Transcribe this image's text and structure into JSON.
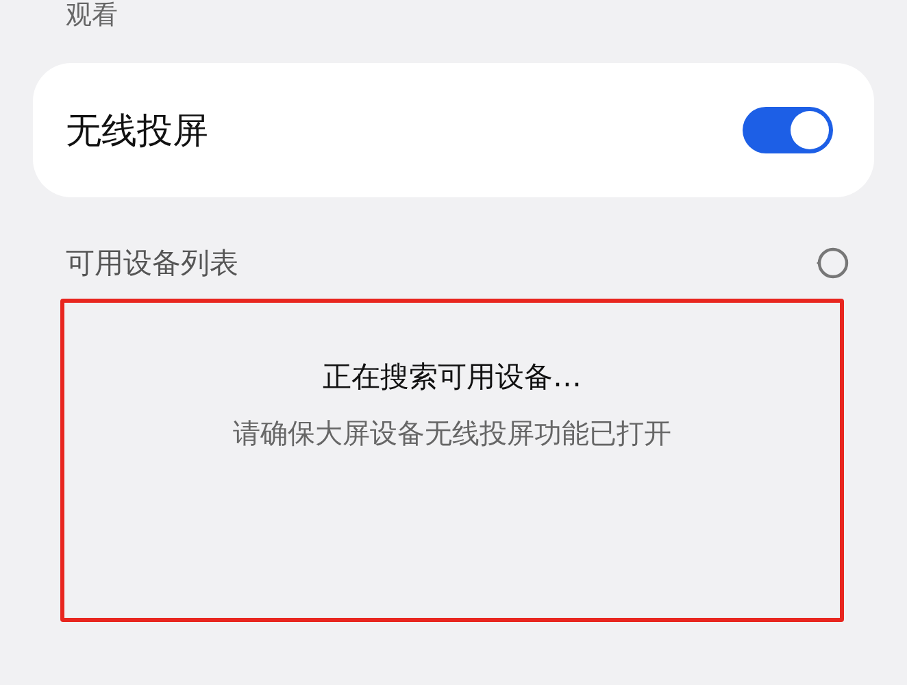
{
  "section_caption": "观看",
  "wireless_projection": {
    "label": "无线投屏",
    "on": true
  },
  "device_list": {
    "title": "可用设备列表",
    "status": "正在搜索可用设备…",
    "hint": "请确保大屏设备无线投屏功能已打开"
  }
}
